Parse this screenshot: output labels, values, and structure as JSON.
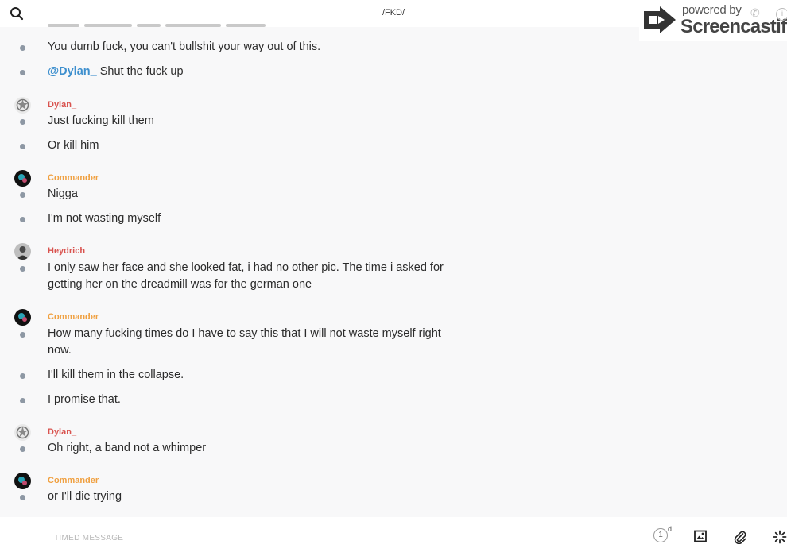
{
  "header": {
    "title": "/FKD/",
    "search_icon": "search-icon"
  },
  "watermark": {
    "powered": "powered by",
    "brand": "Screencastify"
  },
  "messages": [
    {
      "text": "You dumb fuck, you can't bullshit your way out of this."
    },
    {
      "mention": "@Dylan_",
      "text": " Shut the fuck up"
    },
    {
      "author": "Dylan_",
      "author_color": "#d9534f",
      "text": "Just fucking kill them"
    },
    {
      "text": "Or kill him"
    },
    {
      "author": "Commander",
      "author_color": "#f0a040",
      "text": "Nigga"
    },
    {
      "text": "I'm not wasting myself"
    },
    {
      "author": "Heydrich",
      "author_color": "#d9534f",
      "text": "I only saw her face and she looked fat, i had no other pic. The time i asked for getting her on the dreadmill was for the german one"
    },
    {
      "author": "Commander",
      "author_color": "#f0a040",
      "text": "How many fucking times do I have to say this that I will not waste myself right now."
    },
    {
      "text": "I'll kill them in the collapse."
    },
    {
      "text": "I promise that."
    },
    {
      "author": "Dylan_",
      "author_color": "#d9534f",
      "text": "Oh right, a band not a whimper"
    },
    {
      "author": "Commander",
      "author_color": "#f0a040",
      "text": "or I'll die trying"
    }
  ],
  "composer": {
    "placeholder": "TIMED MESSAGE",
    "timer_value": "1",
    "timer_unit": "d",
    "image_icon": "image-icon",
    "attach_icon": "paperclip-icon",
    "more_icon": "loading-spinner-icon"
  },
  "colors": {
    "mention": "#3d8fce",
    "bullet": "#8e98a4",
    "background": "#f8f8f9"
  }
}
